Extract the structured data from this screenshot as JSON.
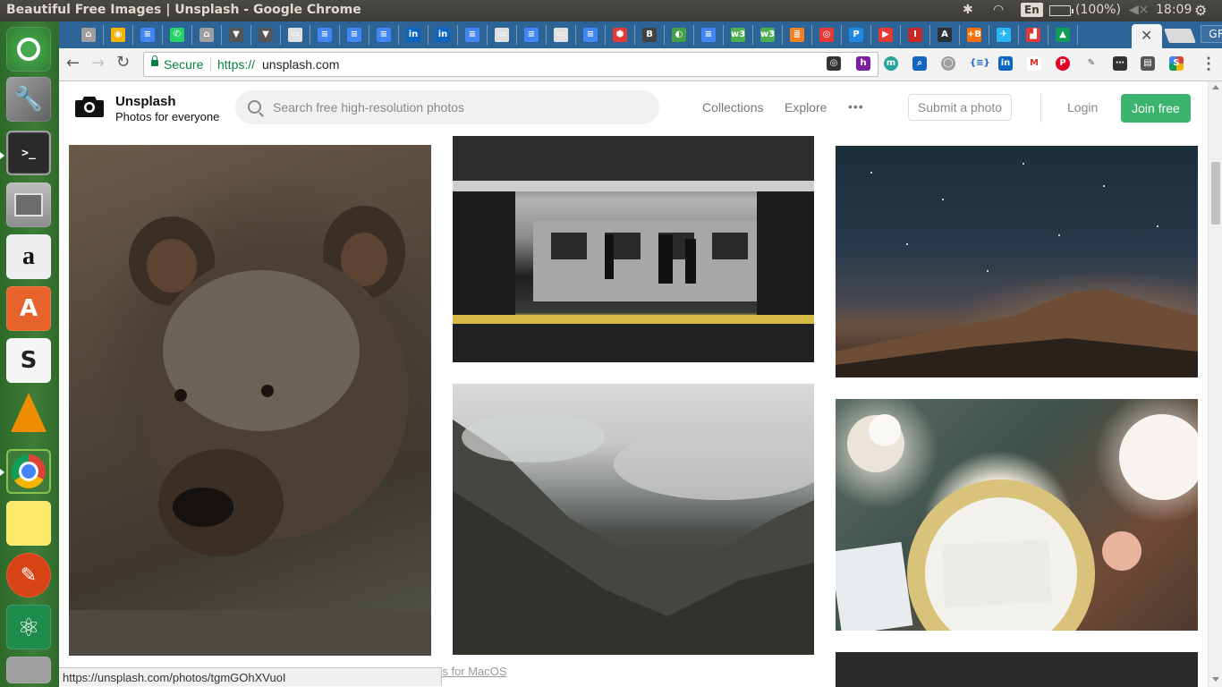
{
  "panel": {
    "window_title": "Beautiful Free Images | Unsplash - Google Chrome",
    "keyboard_lang": "En",
    "battery": "(100%)",
    "clock": "18:09"
  },
  "chrome": {
    "profile_name": "GRANTON",
    "secure_label": "Secure",
    "url_scheme": "https://",
    "url_host": "unsplash.com",
    "status_url": "https://unsplash.com/photos/tgmGOhXVuoI",
    "tab_icons": [
      "bookmark-tree",
      "google-chrome",
      "google-docs",
      "whatsapp",
      "bookmark-tree",
      "down-arrow",
      "down-arrow",
      "blank-page",
      "google-docs",
      "google-docs",
      "google-docs",
      "linkedin",
      "linkedin",
      "google-docs",
      "blank-page",
      "google-docs",
      "blank-page",
      "google-docs",
      "red-hexagon",
      "b-box",
      "green-circle",
      "google-docs",
      "w3",
      "w3",
      "stackoverflow",
      "red-swirl",
      "p-box",
      "youtube",
      "opera-i",
      "a-serif",
      "+b",
      "bird",
      "chart",
      "google-drive"
    ]
  },
  "unsplash": {
    "brand_name": "Unsplash",
    "tagline": "Photos for everyone",
    "search_placeholder": "Search free high-resolution photos",
    "nav": {
      "collections": "Collections",
      "explore": "Explore"
    },
    "submit_photo": "Submit a photo",
    "login": "Login",
    "join": "Join free",
    "credit_partial": "rs for MacOS"
  },
  "colors": {
    "accent_green": "#3cb46e",
    "chrome_tab_strip": "#2c6497",
    "secure_green": "#0b8043"
  }
}
